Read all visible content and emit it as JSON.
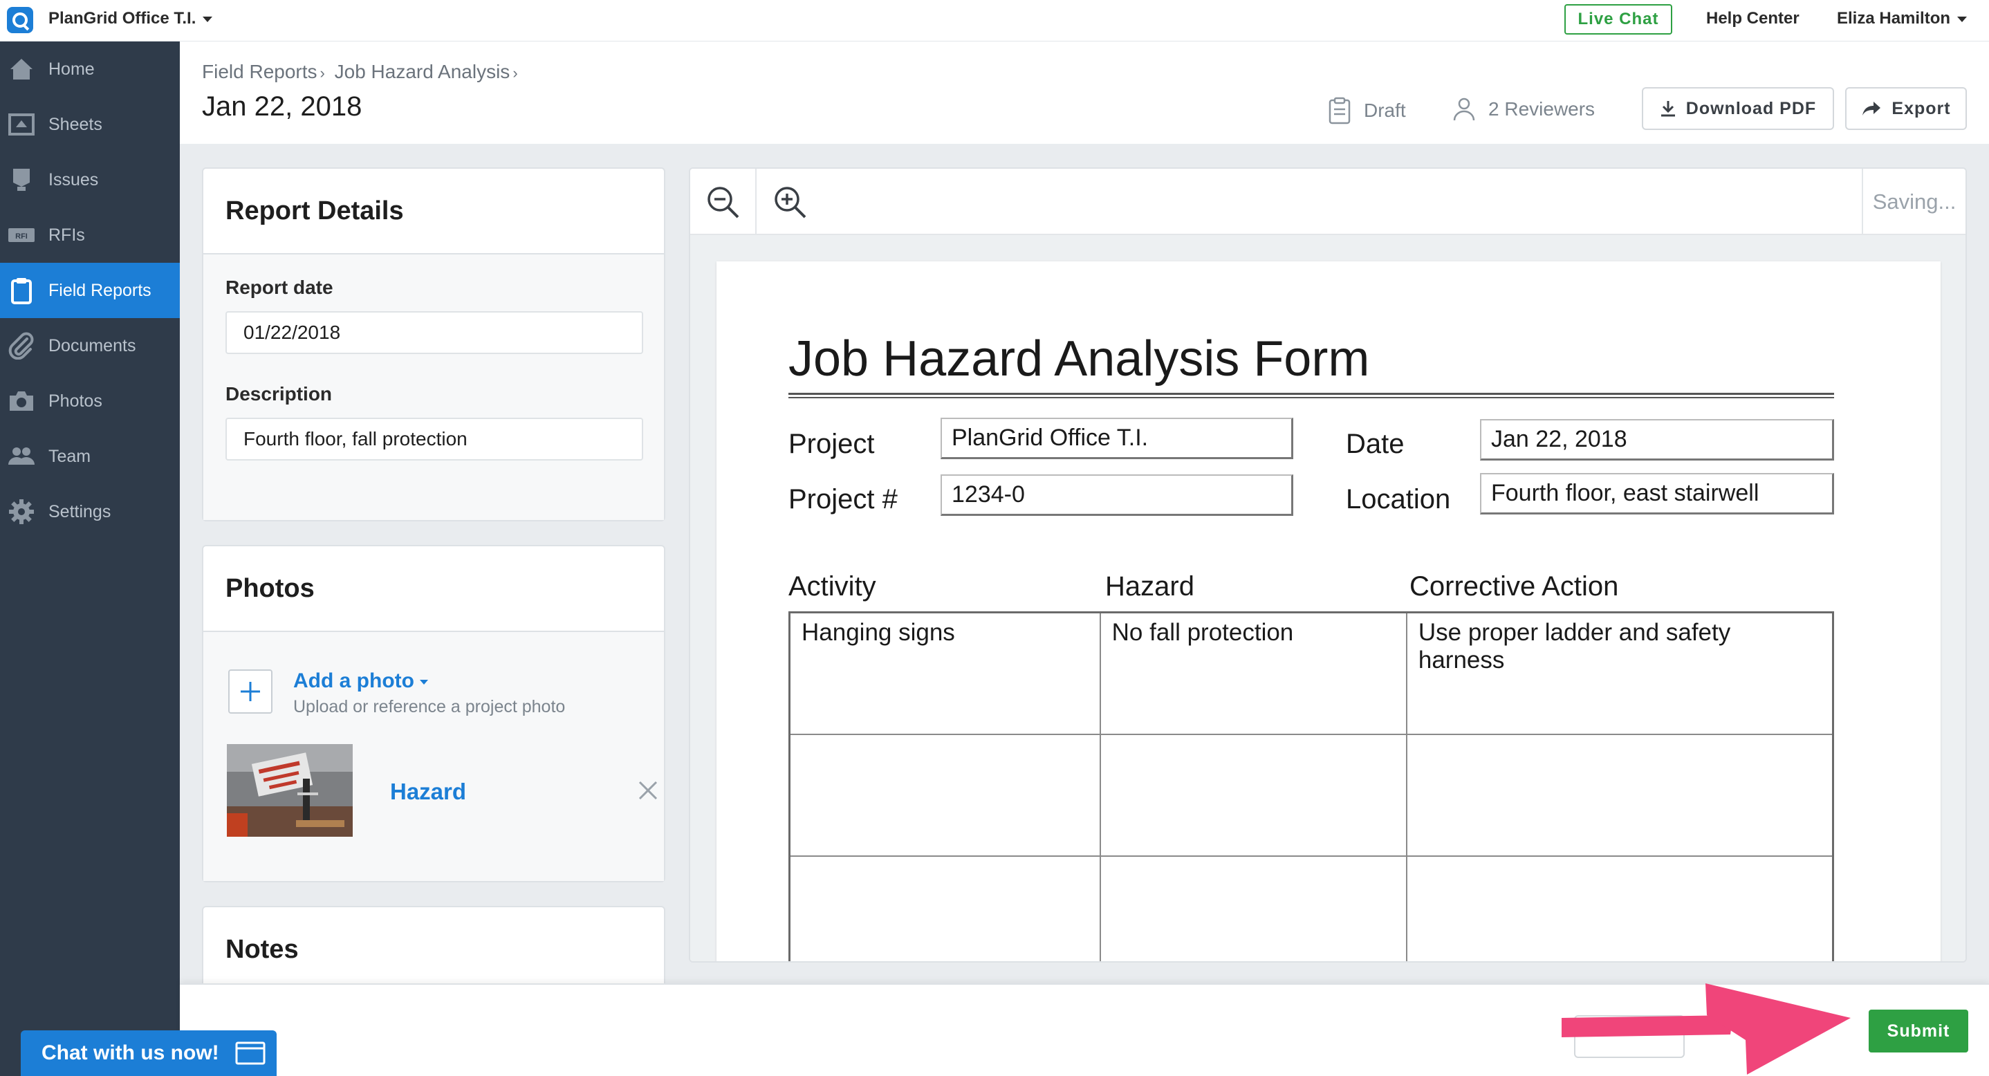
{
  "topbar": {
    "project_name": "PlanGrid Office T.I.",
    "live_chat": "Live Chat",
    "help_center": "Help Center",
    "user_name": "Eliza Hamilton"
  },
  "sidebar": {
    "items": [
      {
        "label": "Home",
        "icon": "home-icon"
      },
      {
        "label": "Sheets",
        "icon": "sheets-icon"
      },
      {
        "label": "Issues",
        "icon": "issues-icon"
      },
      {
        "label": "RFIs",
        "icon": "rfi-icon"
      },
      {
        "label": "Field Reports",
        "icon": "clipboard-icon",
        "active": true
      },
      {
        "label": "Documents",
        "icon": "paperclip-icon"
      },
      {
        "label": "Photos",
        "icon": "camera-icon"
      },
      {
        "label": "Team",
        "icon": "team-icon"
      },
      {
        "label": "Settings",
        "icon": "gear-icon"
      }
    ],
    "rfi_badge": "RFI"
  },
  "header": {
    "breadcrumb": [
      "Field Reports",
      "Job Hazard Analysis"
    ],
    "title": "Jan 22, 2018",
    "status": "Draft",
    "reviewers": "2 Reviewers",
    "download_pdf": "Download PDF",
    "export": "Export"
  },
  "report_details": {
    "title": "Report Details",
    "date_label": "Report date",
    "date_value": "01/22/2018",
    "description_label": "Description",
    "description_value": "Fourth floor, fall protection"
  },
  "photos": {
    "title": "Photos",
    "add_label": "Add a photo",
    "add_sub": "Upload or reference a project photo",
    "items": [
      {
        "label": "Hazard"
      }
    ]
  },
  "notes": {
    "title": "Notes"
  },
  "viewer": {
    "saving": "Saving...",
    "form": {
      "title": "Job Hazard Analysis Form",
      "project_label": "Project",
      "project_value": "PlanGrid Office T.I.",
      "project_num_label": "Project #",
      "project_num_value": "1234-0",
      "date_label": "Date",
      "date_value": "Jan 22, 2018",
      "location_label": "Location",
      "location_value": "Fourth floor, east stairwell",
      "columns": [
        "Activity",
        "Hazard",
        "Corrective Action"
      ],
      "rows": [
        [
          "Hanging signs",
          "No fall protection",
          "Use proper ladder and safety harness"
        ],
        [
          "",
          "",
          ""
        ],
        [
          "",
          "",
          ""
        ]
      ]
    }
  },
  "footer": {
    "submit": "Submit"
  },
  "chat_widget": {
    "label": "Chat with us now!"
  },
  "colors": {
    "accent": "#1c7ed6",
    "sidebar_bg": "#2f3b4a",
    "success": "#2ea043",
    "annotation_arrow": "#f0457a"
  }
}
